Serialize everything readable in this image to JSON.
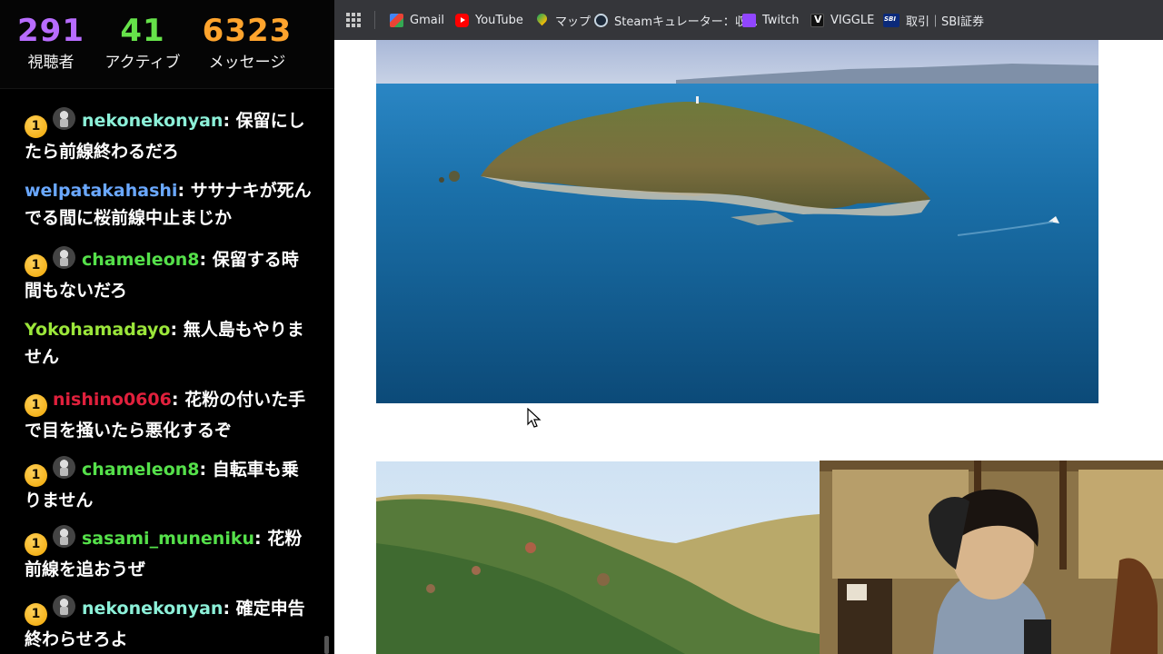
{
  "stats": {
    "viewers": {
      "value": "291",
      "label": "視聴者",
      "color": "#b86cff"
    },
    "active": {
      "value": "41",
      "label": "アクティブ",
      "color": "#66e24a"
    },
    "messages": {
      "value": "6323",
      "label": "メッセージ",
      "color": "#ffa42d"
    }
  },
  "chat": {
    "messages": [
      {
        "badges": [
          "sub-badge-1",
          "avatar"
        ],
        "user": "nekonekonyan",
        "user_color": "#8cf0d8",
        "text": "保留にしたら前線終わるだろ"
      },
      {
        "badges": [],
        "user": "welpatakahashi",
        "user_color": "#6aa8ff",
        "text": "ササナキが死んでる間に桜前線中止まじか"
      },
      {
        "badges": [
          "sub-badge-1",
          "avatar"
        ],
        "user": "chameleon8",
        "user_color": "#55e04a",
        "text": "保留する時間もないだろ"
      },
      {
        "badges": [],
        "user": "Yokohamadayo",
        "user_color": "#9be63a",
        "text": "無人島もやりません"
      },
      {
        "badges": [
          "sub-badge-1"
        ],
        "user": "nishino0606",
        "user_color": "#e0203c",
        "text": "花粉の付いた手で目を掻いたら悪化するぞ"
      },
      {
        "badges": [
          "sub-badge-1",
          "avatar"
        ],
        "user": "chameleon8",
        "user_color": "#55e04a",
        "text": "自転車も乗りません"
      },
      {
        "badges": [
          "sub-badge-1",
          "avatar"
        ],
        "user": "sasami_muneniku",
        "user_color": "#55e04a",
        "text": "花粉前線を追おうぜ"
      },
      {
        "badges": [
          "sub-badge-1",
          "avatar"
        ],
        "user": "nekonekonyan",
        "user_color": "#8cf0d8",
        "text": "確定申告終わらせろよ"
      }
    ],
    "sub_badge_text": "1",
    "separator": ": "
  },
  "bookmarks": [
    {
      "icon": "gmail-icon",
      "label": "Gmail"
    },
    {
      "icon": "youtube-icon",
      "label": "YouTube"
    },
    {
      "icon": "maps-icon",
      "label": "マップ"
    },
    {
      "icon": "steam-icon",
      "label": "Steamキュレーター：収..."
    },
    {
      "icon": "twitch-icon",
      "label": "Twitch"
    },
    {
      "icon": "viggle-icon",
      "label": "VIGGLE"
    },
    {
      "icon": "sbi-icon",
      "label": "取引｜SBI証券"
    }
  ]
}
